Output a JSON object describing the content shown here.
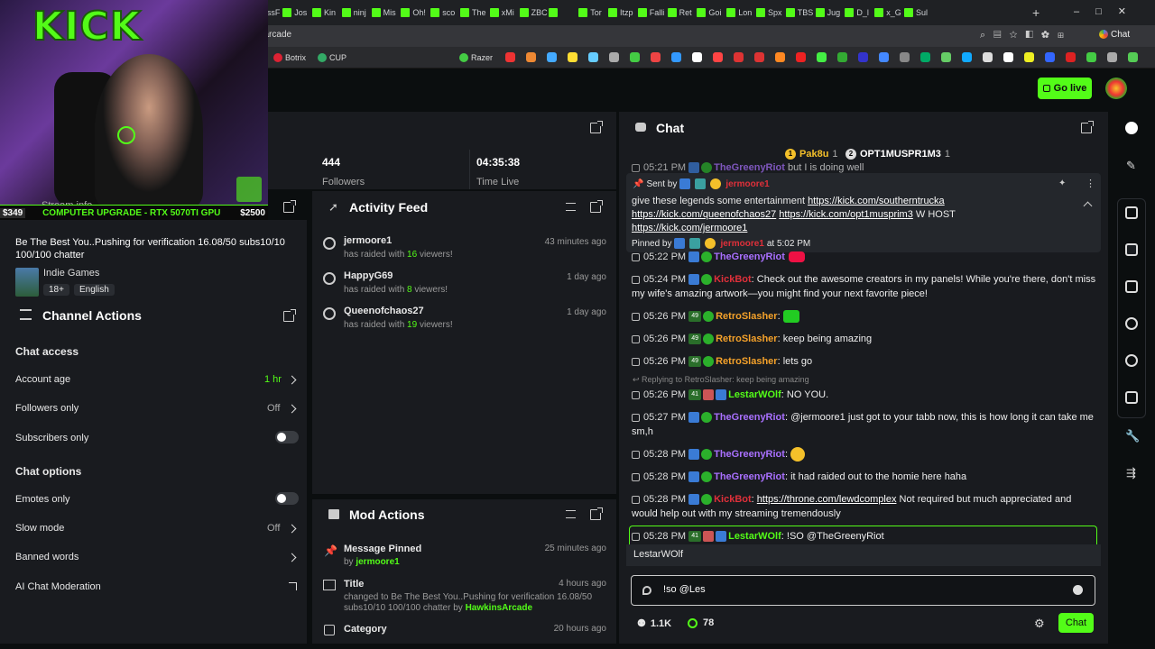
{
  "browser": {
    "tabs": [
      "Str",
      "",
      "Blu",
      "Dev",
      "Ech",
      "",
      "",
      "Ino",
      "IssF",
      "Jos",
      "Kin",
      "ninj",
      "Mis",
      "Oh!",
      "sco",
      "The",
      "xMi",
      "ZBC",
      "",
      "Tor",
      "Itzp",
      "Falli",
      "Ret",
      "Goi",
      "Lon",
      "Spx",
      "TBS",
      "Jug",
      "D_l",
      "x_G",
      "Sul"
    ],
    "url": "d.kick.com/moderator/hawkinsarcade",
    "bookmarks": [
      "Botrix",
      "CUP",
      "Razer"
    ],
    "chat_button": "Chat"
  },
  "header": {
    "go_live": "Go live"
  },
  "webcam": {
    "logo": "KICK",
    "banner_left": "$349",
    "banner_mid": "COMPUTER UPGRADE - RTX 5070TI GPU",
    "banner_right": "$2500",
    "overlay_label": "Stream info"
  },
  "stats": {
    "followers_value": "444",
    "followers_label": "Followers",
    "time_value": "04:35:38",
    "time_label": "Time Live"
  },
  "stream_info": {
    "title": "Be The Best You..Pushing for verification 16.08/50 subs10/10 100/100 chatter",
    "category": "Indie Games",
    "tags": [
      "18+",
      "English"
    ]
  },
  "channel_actions": {
    "title": "Channel Actions",
    "chat_access_heading": "Chat access",
    "account_age_label": "Account age",
    "account_age_value": "1 hr",
    "followers_only_label": "Followers only",
    "followers_only_value": "Off",
    "subscribers_only_label": "Subscribers only",
    "chat_options_heading": "Chat options",
    "emotes_only_label": "Emotes only",
    "slow_mode_label": "Slow mode",
    "slow_mode_value": "Off",
    "banned_words_label": "Banned words",
    "ai_moderation_label": "AI Chat Moderation"
  },
  "activity_feed": {
    "title": "Activity Feed",
    "items": [
      {
        "user": "jermoore1",
        "pre": "has raided with ",
        "count": "16",
        "post": " viewers!",
        "time": "43 minutes ago"
      },
      {
        "user": "HappyG69",
        "pre": "has raided with ",
        "count": "8",
        "post": " viewers!",
        "time": "1 day ago"
      },
      {
        "user": "Queenofchaos27",
        "pre": "has raided with ",
        "count": "19",
        "post": " viewers!",
        "time": "1 day ago"
      }
    ]
  },
  "mod_actions": {
    "title": "Mod Actions",
    "items": [
      {
        "title": "Message Pinned",
        "by_pre": "by ",
        "by_user": "jermoore1",
        "time": "25 minutes ago"
      },
      {
        "title": "Title",
        "desc": "changed to Be The Best You..Pushing for verification 16.08/50 subs10/10 100/100 chatter",
        "by_pre": " by ",
        "by_user": "HawkinsArcade",
        "time": "4 hours ago"
      },
      {
        "title": "Category",
        "time": "20 hours ago"
      }
    ]
  },
  "chat": {
    "title": "Chat",
    "top_users": [
      {
        "rank": "1",
        "name": "Pak8u",
        "count": "1"
      },
      {
        "rank": "2",
        "name": "OPT1MUSPR1M3",
        "count": "1"
      }
    ],
    "pinned": {
      "sent_by_label": "Sent by",
      "sender": "jermoore1",
      "text_pre": "give these legends some entertainment ",
      "links": [
        "https://kick.com/southerntrucka",
        "https://kick.com/queenofchaos27",
        "https://kick.com/opt1musprim3",
        "https://kick.com/jermoore1"
      ],
      "w_host": " W HOST",
      "pinned_by_label": "Pinned by",
      "pinned_by_user": "jermoore1",
      "pinned_at": "at 5:02 PM"
    },
    "messages": [
      {
        "time": "05:24 PM",
        "user": "KickBot",
        "text": "Check out the awesome creators in my panels! While you're there, don't miss my wife's amazing artwork—you might find your next favorite piece!"
      },
      {
        "time": "05:26 PM",
        "user": "RetroSlasher",
        "text": "",
        "sub": "49"
      },
      {
        "time": "05:26 PM",
        "user": "RetroSlasher",
        "text": "keep being amazing",
        "sub": "49"
      },
      {
        "time": "05:26 PM",
        "user": "RetroSlasher",
        "text": "lets go",
        "sub": "49"
      },
      {
        "reply": "Replying to RetroSlasher: keep being amazing",
        "time": "05:26 PM",
        "user": "LestarWOlf",
        "text": "NO YOU.",
        "sub": "41"
      },
      {
        "time": "05:27 PM",
        "user": "TheGreenyRiot",
        "text": "@jermoore1 just got to your tabb now, this is how long it can take me sm,h"
      },
      {
        "time": "05:28 PM",
        "user": "TheGreenyRiot",
        "text": ""
      },
      {
        "time": "05:28 PM",
        "user": "TheGreenyRiot",
        "text": "it had raided out to the homie here haha"
      },
      {
        "time": "05:28 PM",
        "user": "KickBot",
        "link": "https://throne.com/lewdcomplex",
        "text": " Not required but much appreciated and would help out with my streaming tremendously"
      },
      {
        "time": "05:28 PM",
        "user": "LestarWOlf",
        "text": "!SO @TheGreenyRiot",
        "sub": "41"
      }
    ],
    "partial_prev_time": "05:21 PM",
    "partial_prev_user": "TheGreenyRiot",
    "partial_prev_text": "but I is doing well",
    "partial_prev2_time": "05:22 PM",
    "partial_prev2_user": "TheGreenyRiot",
    "suggestion": "LestarWOlf",
    "input_value": "!so @Les",
    "viewers": "1.1K",
    "points": "78",
    "send_label": "Chat"
  }
}
